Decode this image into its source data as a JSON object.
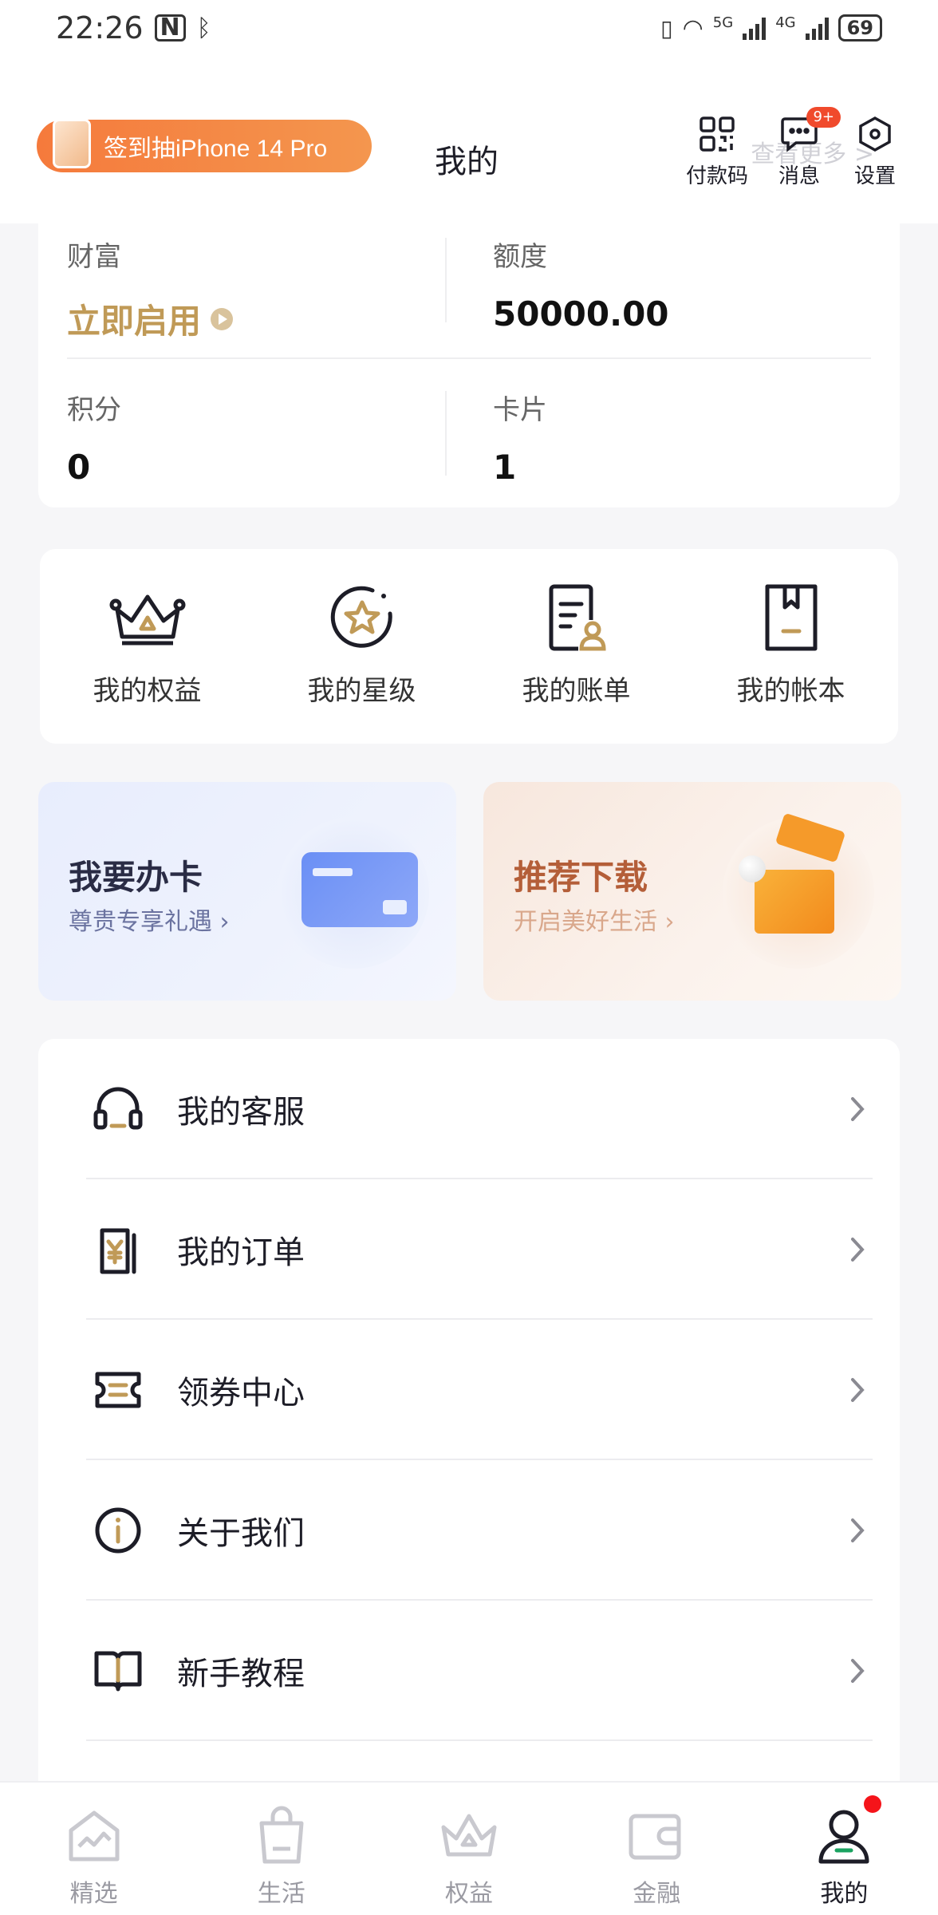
{
  "status_bar": {
    "time": "22:26",
    "battery": "69",
    "net1": "5G",
    "net2": "4G"
  },
  "header": {
    "signin_label": "签到抽iPhone 14 Pro",
    "title": "我的",
    "pay_code": "付款码",
    "messages": "消息",
    "messages_badge": "9+",
    "settings": "设置",
    "ghost_more": "查看更多 >"
  },
  "summary": {
    "wealth_label": "财富",
    "wealth_value": "立即启用",
    "quota_label": "额度",
    "quota_value": "50000.00",
    "points_label": "积分",
    "points_value": "0",
    "cards_label": "卡片",
    "cards_value": "1"
  },
  "quick": {
    "items": [
      {
        "label": "我的权益",
        "icon": "crown-icon"
      },
      {
        "label": "我的星级",
        "icon": "star-badge-icon"
      },
      {
        "label": "我的账单",
        "icon": "bill-icon"
      },
      {
        "label": "我的帐本",
        "icon": "ledger-icon"
      }
    ]
  },
  "promos": {
    "card_title": "我要办卡",
    "card_sub": "尊贵专享礼遇",
    "dl_title": "推荐下载",
    "dl_sub": "开启美好生活"
  },
  "menu": {
    "items": [
      {
        "label": "我的客服",
        "icon": "headset-icon"
      },
      {
        "label": "我的订单",
        "icon": "order-icon"
      },
      {
        "label": "领券中心",
        "icon": "coupon-icon"
      },
      {
        "label": "关于我们",
        "icon": "info-icon"
      },
      {
        "label": "新手教程",
        "icon": "book-icon"
      }
    ]
  },
  "tabs": {
    "items": [
      {
        "label": "精选",
        "icon": "featured-icon"
      },
      {
        "label": "生活",
        "icon": "bag-icon"
      },
      {
        "label": "权益",
        "icon": "crown-icon"
      },
      {
        "label": "金融",
        "icon": "wallet-icon"
      },
      {
        "label": "我的",
        "icon": "user-icon"
      }
    ],
    "active": "我的"
  },
  "colors": {
    "accent_gold": "#c09a57",
    "signin_orange": "#f57a3c",
    "badge_red": "#f04a2c",
    "dark": "#1d1d27"
  }
}
